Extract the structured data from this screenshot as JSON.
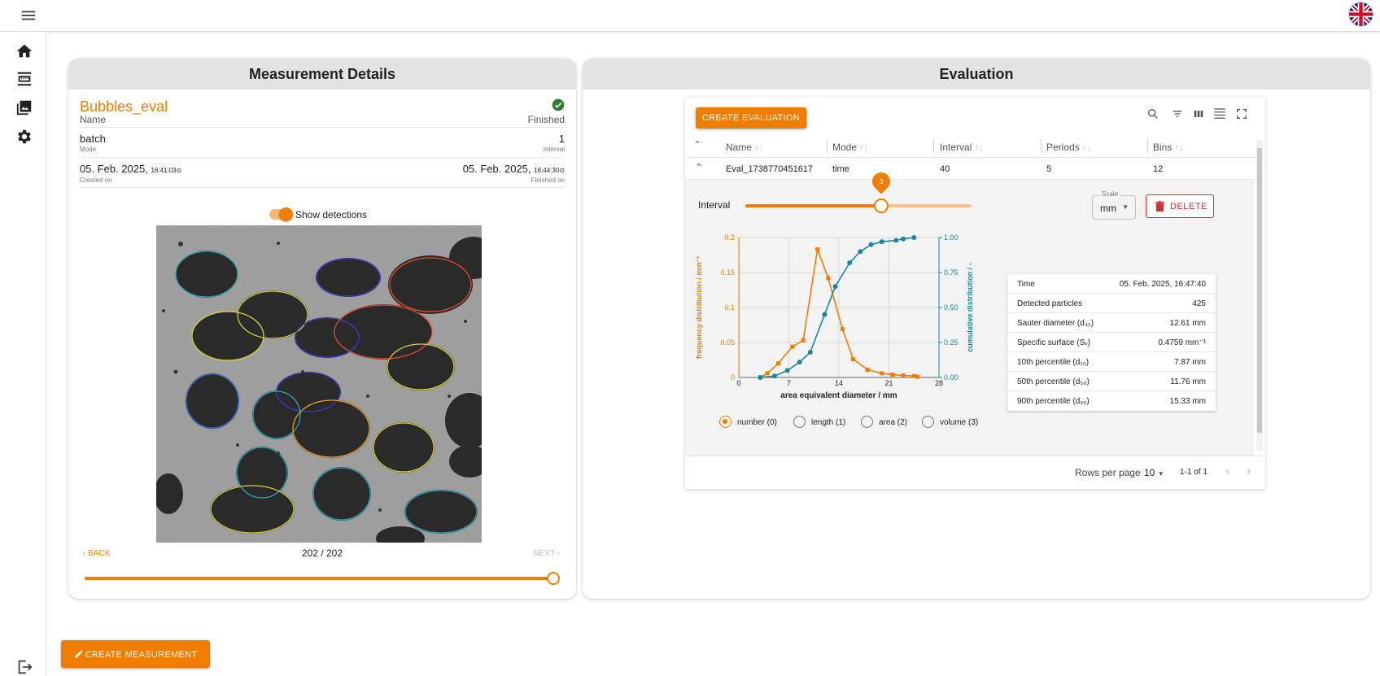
{
  "icons": {
    "menu": "menu-icon",
    "language": "uk-flag-icon",
    "home": "home-icon",
    "measurement": "measurement-icon",
    "images": "images-icon",
    "settings": "gear-icon",
    "logout": "logout-icon"
  },
  "measurement": {
    "panel_title": "Measurement Details",
    "name": "Bubbles_eval",
    "name_label": "Name",
    "status": "Finished",
    "mode": "batch",
    "mode_label": "Mode",
    "interval": "1",
    "interval_label": "Interval",
    "created_date": "05. Feb. 2025",
    "created_time": "16:41:03",
    "created_label": "Created on",
    "finished_date": "05. Feb. 2025",
    "finished_time": "16:44:30",
    "finished_label": "Finished on",
    "show_detections_label": "Show detections",
    "show_detections_on": true,
    "back_label": "BACK",
    "next_label": "NEXT",
    "frame_counter": "202 / 202",
    "frame_progress": 1.0
  },
  "evaluation": {
    "panel_title": "Evaluation",
    "create_label": "CREATE EVALUATION",
    "columns": [
      "Name",
      "Mode",
      "Interval",
      "Periods",
      "Bins"
    ],
    "rows": [
      {
        "name": "Eval_1738770451617",
        "mode": "time",
        "interval": "40",
        "periods": "5",
        "bins": "12"
      }
    ],
    "interval_slider_label": "Interval",
    "interval_slider_value": "3",
    "interval_slider_max": 5,
    "scale_label": "Scale",
    "scale_value": "mm",
    "delete_label": "DELETE",
    "stats": [
      {
        "key": "Time",
        "value": "05. Feb. 2025, 16:47:40"
      },
      {
        "key": "Detected particles",
        "value": "425"
      },
      {
        "key": "Sauter diameter (d₃₂)",
        "value": "12.61 mm"
      },
      {
        "key": "Specific surface (Sᵥ)",
        "value": "0.4759 mm⁻¹"
      },
      {
        "key": "10th percentile (d₁₀)",
        "value": "7.87 mm"
      },
      {
        "key": "50th percentile (d₅₀)",
        "value": "11.76 mm"
      },
      {
        "key": "90th percentile (d₉₀)",
        "value": "15.33 mm"
      }
    ],
    "radio_options": [
      "number (0)",
      "length (1)",
      "area (2)",
      "volume (3)"
    ],
    "radio_selected": 0,
    "rows_per_page_label": "Rows per page",
    "rows_per_page_value": "10",
    "pagination_range": "1-1 of 1"
  },
  "create_measurement_label": "CREATE MEASUREMENT",
  "chart_data": {
    "type": "line",
    "xlabel": "area equivalent diameter / mm",
    "ylabel": "frequency distribution / mm⁻¹",
    "ylabel_right": "cumulative distribution / -",
    "xlim": [
      0,
      28
    ],
    "ylim": [
      0,
      0.2
    ],
    "ylim_right": [
      0,
      1.0
    ],
    "xticks": [
      "0",
      "7",
      "14",
      "21",
      "28"
    ],
    "yticks": [
      "0",
      "0.05",
      "0.1",
      "0.15",
      "0.2"
    ],
    "yticks_right": [
      "0.00",
      "0.25",
      "0.50",
      "0.75",
      "1.00"
    ],
    "grid": true,
    "series": [
      {
        "axis": "left",
        "color": "#ef7d00",
        "marker": "square",
        "x": [
          3.0,
          4.0,
          5.5,
          7.5,
          9.0,
          11.0,
          12.5,
          14.5,
          16.0,
          18.0,
          20.0,
          21.5,
          23.0,
          24.5,
          25.0
        ],
        "y": [
          0.0,
          0.006,
          0.02,
          0.044,
          0.053,
          0.183,
          0.142,
          0.069,
          0.026,
          0.011,
          0.006,
          0.004,
          0.003,
          0.002,
          0.001
        ]
      },
      {
        "axis": "right",
        "color": "#1a87a0",
        "marker": "circle",
        "x": [
          3.0,
          5.0,
          6.8,
          8.5,
          10.0,
          12.0,
          13.5,
          15.5,
          17.0,
          18.5,
          20.0,
          22.0,
          23.0,
          24.5
        ],
        "y": [
          0.0,
          0.01,
          0.05,
          0.11,
          0.18,
          0.45,
          0.65,
          0.82,
          0.9,
          0.95,
          0.97,
          0.98,
          0.99,
          1.0
        ]
      }
    ]
  }
}
